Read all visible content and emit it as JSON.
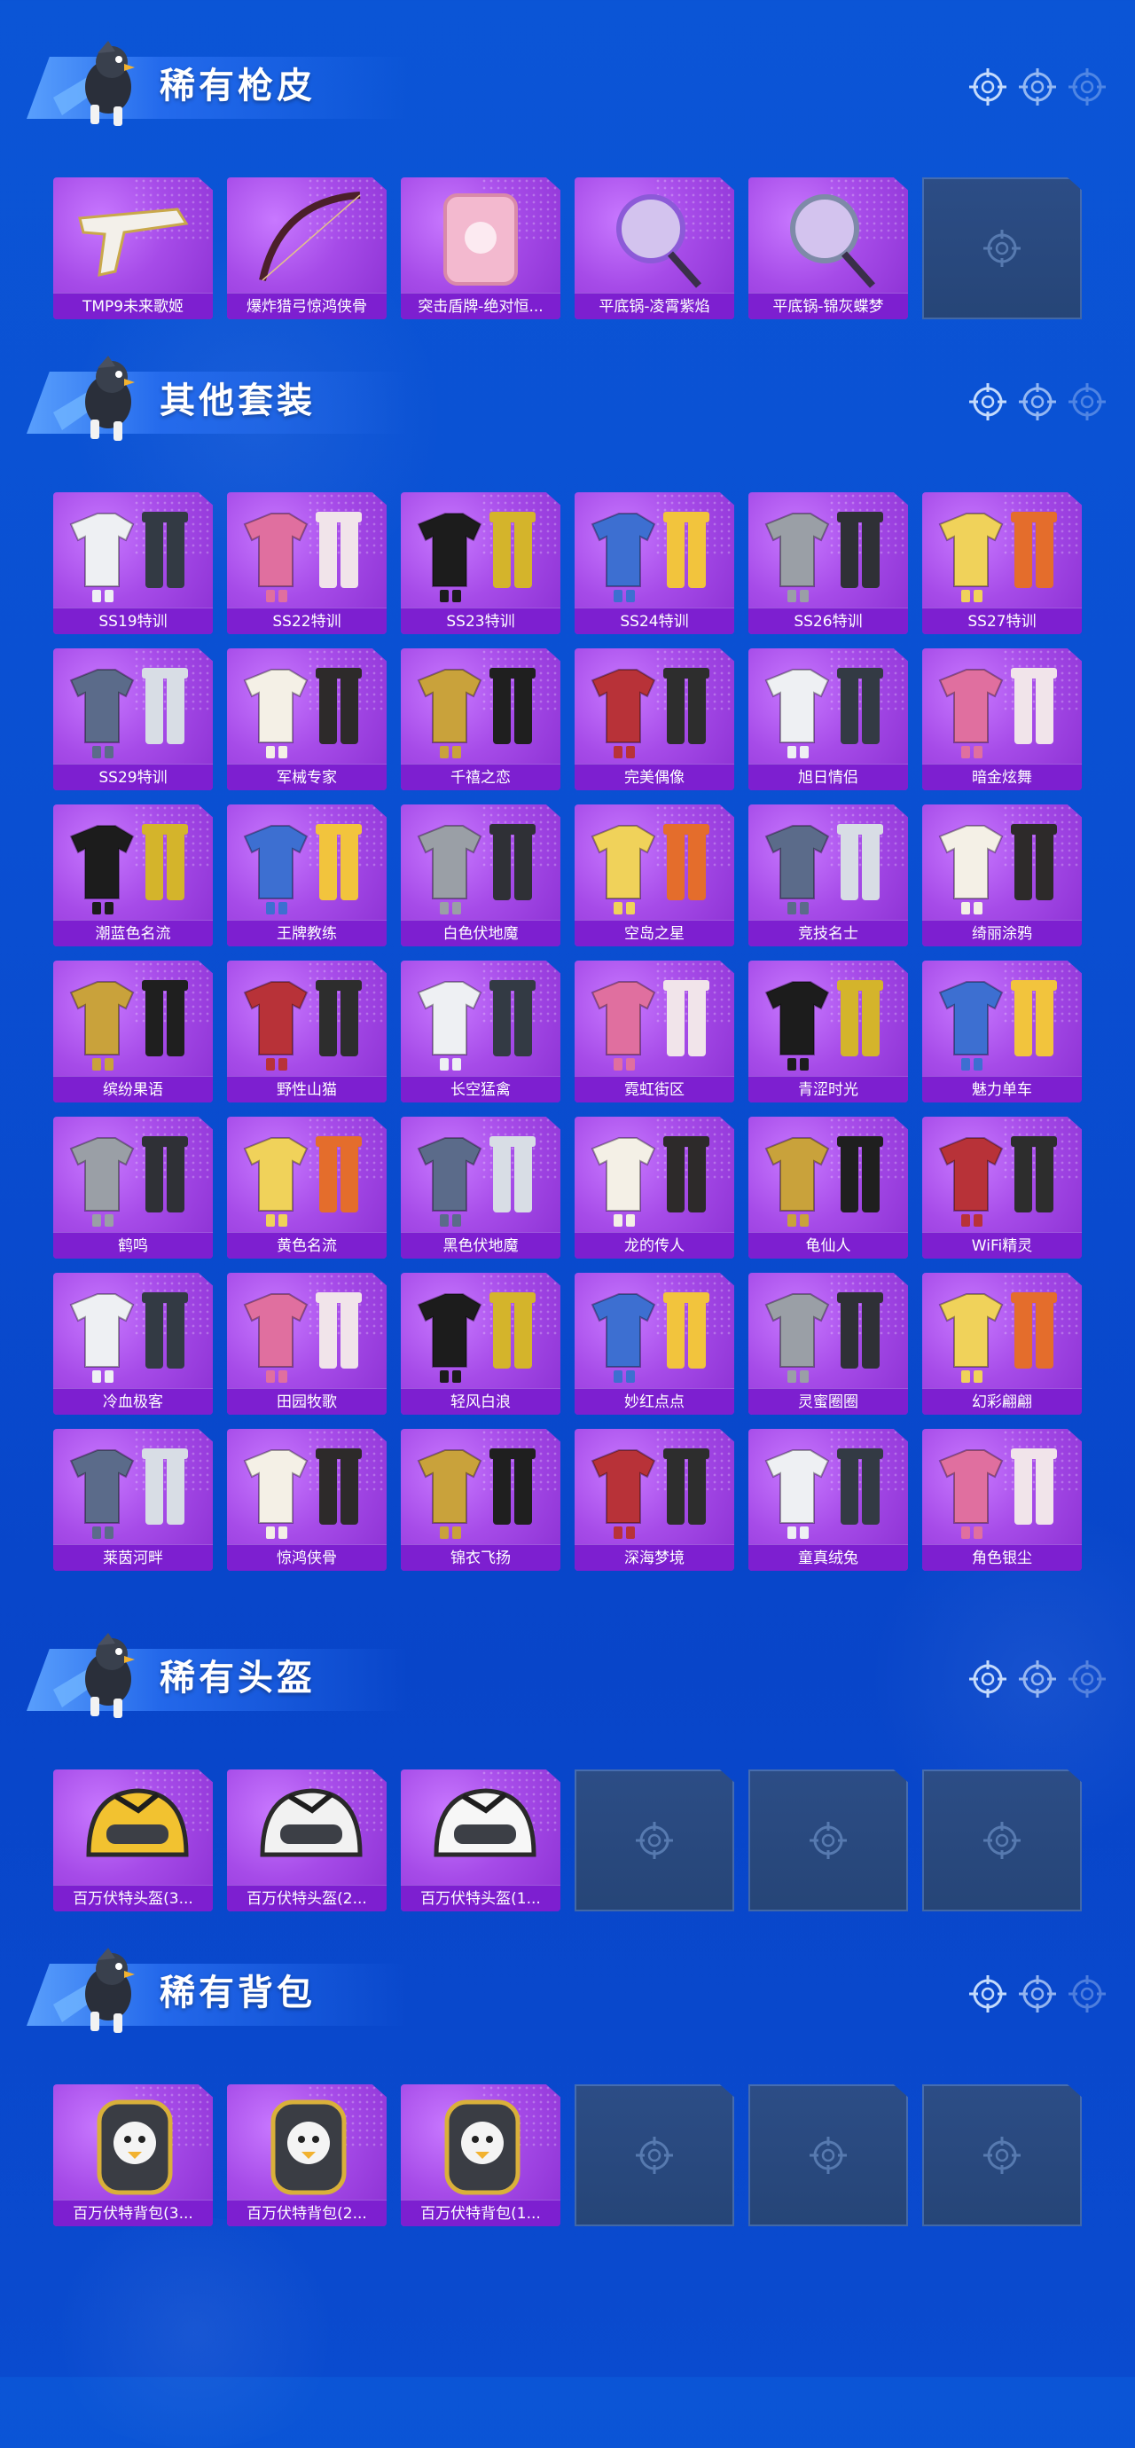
{
  "colors": {
    "background": "#0b55d6",
    "tile_purple": "#a64be8",
    "label_bar": "#7d1fd0",
    "empty_slot": "#2c4d86"
  },
  "sections": [
    {
      "title": "稀有枪皮",
      "items": [
        "TMP9未来歌姬",
        "爆炸猎弓惊鸿侠骨",
        "突击盾牌-绝对恒...",
        "平底锅-凌霄紫焰",
        "平底锅-锦灰蝶梦"
      ],
      "empty_slots": 1
    },
    {
      "title": "其他套装",
      "items": [
        "SS19特训",
        "SS22特训",
        "SS23特训",
        "SS24特训",
        "SS26特训",
        "SS27特训",
        "SS29特训",
        "军械专家",
        "千禧之恋",
        "完美偶像",
        "旭日情侣",
        "暗金炫舞",
        "潮蓝色名流",
        "王牌教练",
        "白色伏地魔",
        "空岛之星",
        "竞技名士",
        "绮丽涂鸦",
        "缤纷果语",
        "野性山猫",
        "长空猛禽",
        "霓虹街区",
        "青涩时光",
        "魅力单车",
        "鹤鸣",
        "黄色名流",
        "黑色伏地魔",
        "龙的传人",
        "龟仙人",
        "WiFi精灵",
        "冷血极客",
        "田园牧歌",
        "轻风白浪",
        "妙红点点",
        "灵蜜圈圈",
        "幻彩翩翩",
        "莱茵河畔",
        "惊鸿侠骨",
        "锦衣飞扬",
        "深海梦境",
        "童真绒兔",
        "角色银尘"
      ],
      "empty_slots": 0
    },
    {
      "title": "稀有头盔",
      "items": [
        "百万伏特头盔(3...",
        "百万伏特头盔(2...",
        "百万伏特头盔(1..."
      ],
      "empty_slots": 3
    },
    {
      "title": "稀有背包",
      "items": [
        "百万伏特背包(3...",
        "百万伏特背包(2...",
        "百万伏特背包(1..."
      ],
      "empty_slots": 3
    }
  ]
}
